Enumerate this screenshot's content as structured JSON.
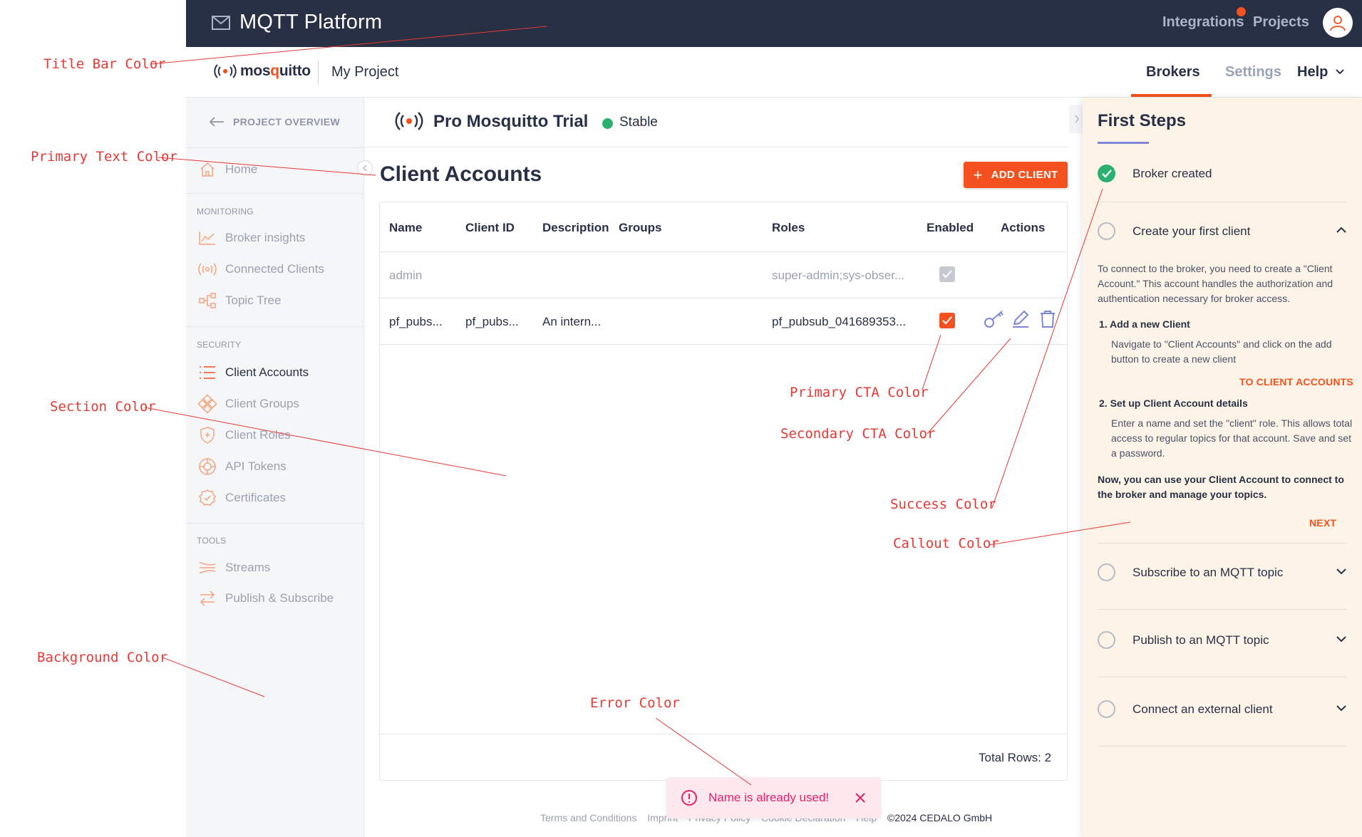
{
  "titlebar": {
    "app_title": "MQTT Platform",
    "nav_integrations": "Integrations",
    "nav_projects": "Projects",
    "icons": [
      "mail-icon",
      "user-icon"
    ]
  },
  "subheader": {
    "logo_prefix": "mos",
    "logo_q": "q",
    "logo_suffix": "uitto",
    "project_name": "My Project",
    "tabs": {
      "brokers": "Brokers",
      "settings": "Settings",
      "help": "Help"
    }
  },
  "sidebar": {
    "back_label": "PROJECT OVERVIEW",
    "home": "Home",
    "monitoring_title": "MONITORING",
    "broker_insights": "Broker insights",
    "connected_clients": "Connected Clients",
    "topic_tree": "Topic Tree",
    "security_title": "SECURITY",
    "client_accounts": "Client Accounts",
    "client_groups": "Client Groups",
    "client_roles": "Client Roles",
    "api_tokens": "API Tokens",
    "certificates": "Certificates",
    "tools_title": "TOOLS",
    "streams": "Streams",
    "publish_subscribe": "Publish & Subscribe"
  },
  "main": {
    "broker_name": "Pro Mosquitto Trial",
    "broker_status": "Stable",
    "page_title": "Client Accounts",
    "add_button": "ADD CLIENT",
    "table": {
      "headers": [
        "Name",
        "Client ID",
        "Description",
        "Groups",
        "Roles",
        "Enabled",
        "Actions"
      ],
      "rows": [
        {
          "name": "admin",
          "client_id": "",
          "description": "",
          "groups": "",
          "roles": "super-admin;sys-obser...",
          "enabled": true,
          "editable": false
        },
        {
          "name": "pf_pubs...",
          "client_id": "pf_pubs...",
          "description": "An intern...",
          "groups": "",
          "roles": "pf_pubsub_041689353...",
          "enabled": true,
          "editable": true
        }
      ],
      "total_rows": "Total Rows: 2"
    }
  },
  "footer": {
    "links": [
      "Terms and Conditions",
      "Imprint",
      "Privacy Policy",
      "Cookie Declaration",
      "Help"
    ],
    "copyright": "©2024 CEDALO GmbH"
  },
  "toast": {
    "message": "Name is already used!"
  },
  "first_steps": {
    "title": "First Steps",
    "step1": "Broker created",
    "step2": "Create your first client",
    "intro": "To connect to the broker, you need to create a \"Client Account.\" This account handles the authorization and authentication necessary for broker access.",
    "sub1_title": "1. Add a new Client",
    "sub1_body": "Navigate to \"Client Accounts\" and click on the add button to create a new client",
    "sub1_link": "TO CLIENT ACCOUNTS",
    "sub2_title": "2. Set up Client Account details",
    "sub2_body": "Enter a name and set the \"client\" role. This allows total access to regular topics for that account. Save and set a password.",
    "outro": "Now, you can use your Client Account to connect to the broker and manage your topics.",
    "next": "NEXT",
    "step3": "Subscribe to an MQTT topic",
    "step4": "Publish to an MQTT topic",
    "step5": "Connect an external client"
  },
  "annotations": {
    "title_bar": "Title Bar Color",
    "primary_text": "Primary Text Color",
    "section": "Section Color",
    "background": "Background Color",
    "primary_cta": "Primary CTA Color",
    "secondary_cta": "Secondary CTA Color",
    "success": "Success Color",
    "callout": "Callout Color",
    "error": "Error Color"
  },
  "colors": {
    "title_bar": "#283046",
    "primary_text": "#283046",
    "primary_cta": "#f4511e",
    "secondary_cta": "#7e86d8",
    "success": "#2ab06f",
    "callout": "#fdf3e7",
    "error": "#e6206a",
    "section": "#ffffff",
    "background": "#f5f6f8",
    "annotation": "#e53935"
  }
}
